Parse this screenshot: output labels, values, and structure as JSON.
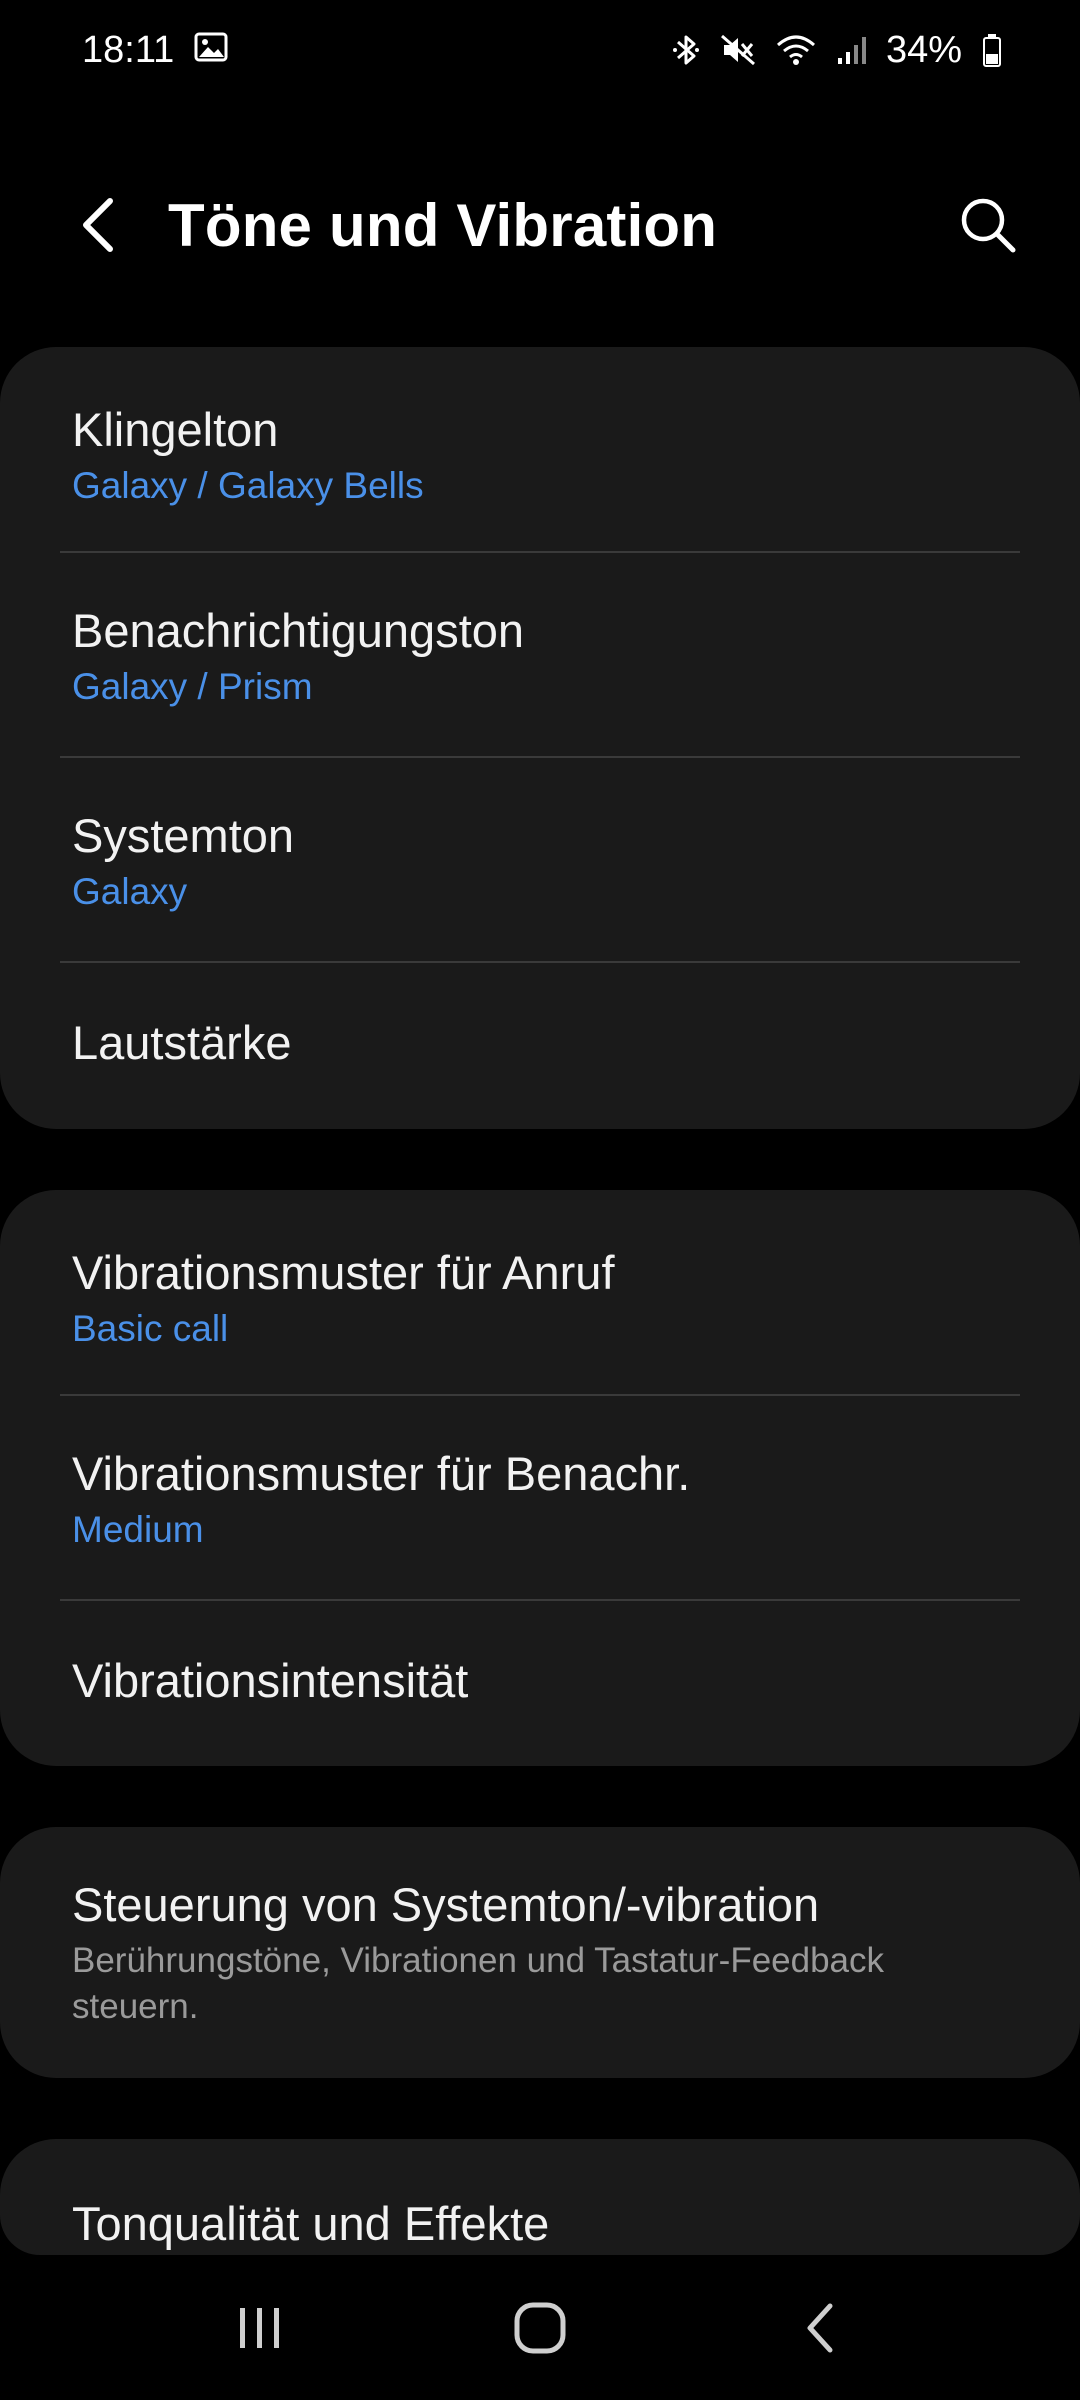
{
  "status_bar": {
    "time": "18:11",
    "battery_percent": "34%",
    "icons": [
      "gallery-icon",
      "bluetooth-icon",
      "mute-icon",
      "wifi-icon",
      "signal-icon",
      "battery-icon"
    ]
  },
  "header": {
    "title": "Töne und Vibration",
    "back_icon": "back-arrow-icon",
    "search_icon": "search-icon"
  },
  "groups": [
    {
      "items": [
        {
          "title": "Klingelton",
          "subtitle": "Galaxy / Galaxy Bells"
        },
        {
          "title": "Benachrichtigungston",
          "subtitle": "Galaxy / Prism"
        },
        {
          "title": "Systemton",
          "subtitle": "Galaxy"
        },
        {
          "title": "Lautstärke"
        }
      ]
    },
    {
      "items": [
        {
          "title": "Vibrationsmuster für Anruf",
          "subtitle": "Basic call"
        },
        {
          "title": "Vibrationsmuster für Benachr.",
          "subtitle": "Medium"
        },
        {
          "title": "Vibrationsintensität"
        }
      ]
    },
    {
      "items": [
        {
          "title": "Steuerung von Systemton/-vibration",
          "description": "Berührungstöne, Vibrationen und Tastatur-Feedback steuern."
        }
      ]
    },
    {
      "items": [
        {
          "title": "Tonqualität und Effekte"
        }
      ]
    }
  ],
  "nav_bar": {
    "icons": [
      "recent-apps-icon",
      "home-icon",
      "back-icon"
    ]
  },
  "colors": {
    "background": "#000000",
    "card": "#1a1a1a",
    "accent": "#4a90e8",
    "divider": "#3a3a3a"
  }
}
